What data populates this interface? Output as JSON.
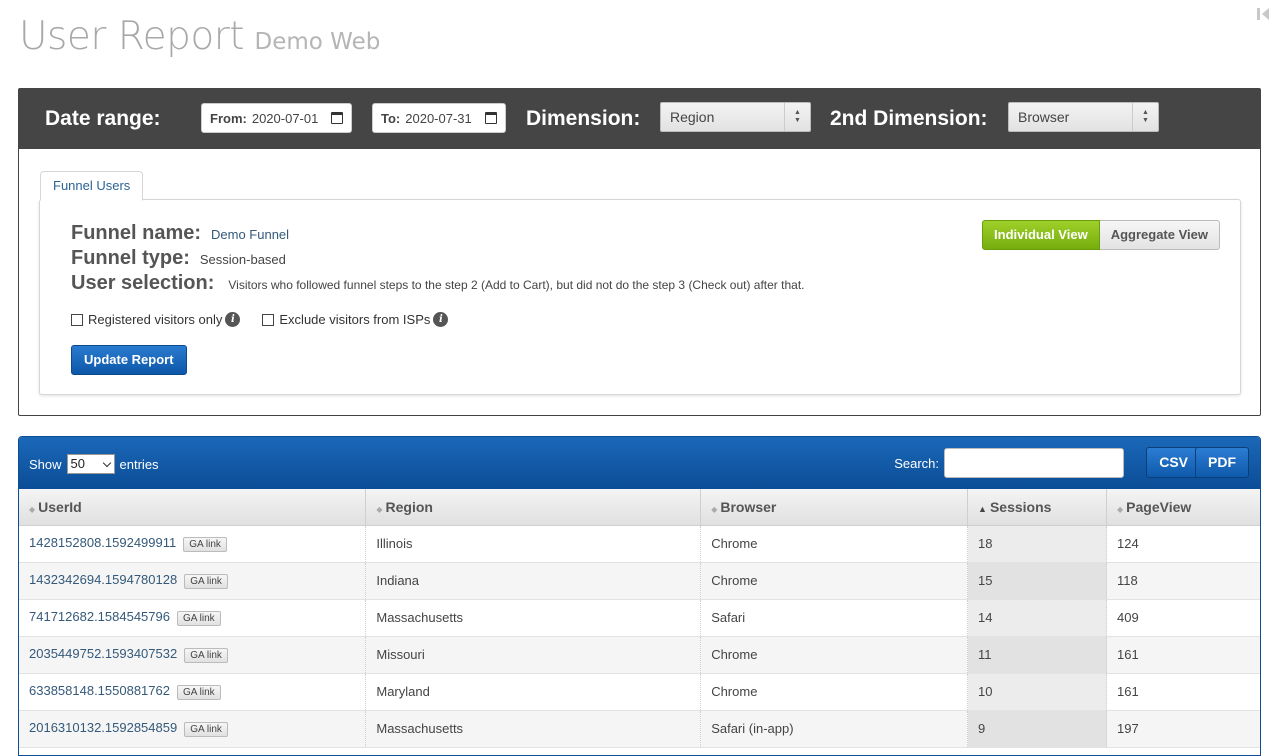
{
  "header": {
    "title": "User Report",
    "subtitle": "Demo Web"
  },
  "filters": {
    "date_range_label": "Date range:",
    "from_label": "From:",
    "from_value": "2020-07-01",
    "to_label": "To:",
    "to_value": "2020-07-31",
    "dimension_label": "Dimension:",
    "dimension_value": "Region",
    "dimension2_label": "2nd Dimension:",
    "dimension2_value": "Browser"
  },
  "funnel": {
    "tab_label": "Funnel Users",
    "name_label": "Funnel name:",
    "name_value": "Demo Funnel",
    "type_label": "Funnel type:",
    "type_value": "Session-based",
    "selection_label": "User selection:",
    "selection_value": "Visitors who followed funnel steps to the step 2 (Add to Cart), but did not do the step 3 (Check out) after that.",
    "registered_only_label": "Registered visitors only",
    "exclude_isps_label": "Exclude visitors from ISPs",
    "update_button": "Update Report",
    "individual_view": "Individual View",
    "aggregate_view": "Aggregate View"
  },
  "table": {
    "show_label": "Show",
    "page_length": "50",
    "entries_label": "entries",
    "search_label": "Search:",
    "csv_button": "CSV",
    "pdf_button": "PDF",
    "ga_link_label": "GA link",
    "columns": [
      "UserId",
      "Region",
      "Browser",
      "Sessions",
      "PageView"
    ],
    "rows": [
      {
        "userid": "1428152808.1592499911",
        "region": "Illinois",
        "browser": "Chrome",
        "sessions": "18",
        "pageview": "124"
      },
      {
        "userid": "1432342694.1594780128",
        "region": "Indiana",
        "browser": "Chrome",
        "sessions": "15",
        "pageview": "118"
      },
      {
        "userid": "741712682.1584545796",
        "region": "Massachusetts",
        "browser": "Safari",
        "sessions": "14",
        "pageview": "409"
      },
      {
        "userid": "2035449752.1593407532",
        "region": "Missouri",
        "browser": "Chrome",
        "sessions": "11",
        "pageview": "161"
      },
      {
        "userid": "633858148.1550881762",
        "region": "Maryland",
        "browser": "Chrome",
        "sessions": "10",
        "pageview": "161"
      },
      {
        "userid": "2016310132.1592854859",
        "region": "Massachusetts",
        "browser": "Safari (in-app)",
        "sessions": "9",
        "pageview": "197"
      }
    ]
  },
  "colors": {
    "accent": "#0b4d97",
    "active_view": "#8cc21c",
    "filter_bar": "#454545"
  }
}
